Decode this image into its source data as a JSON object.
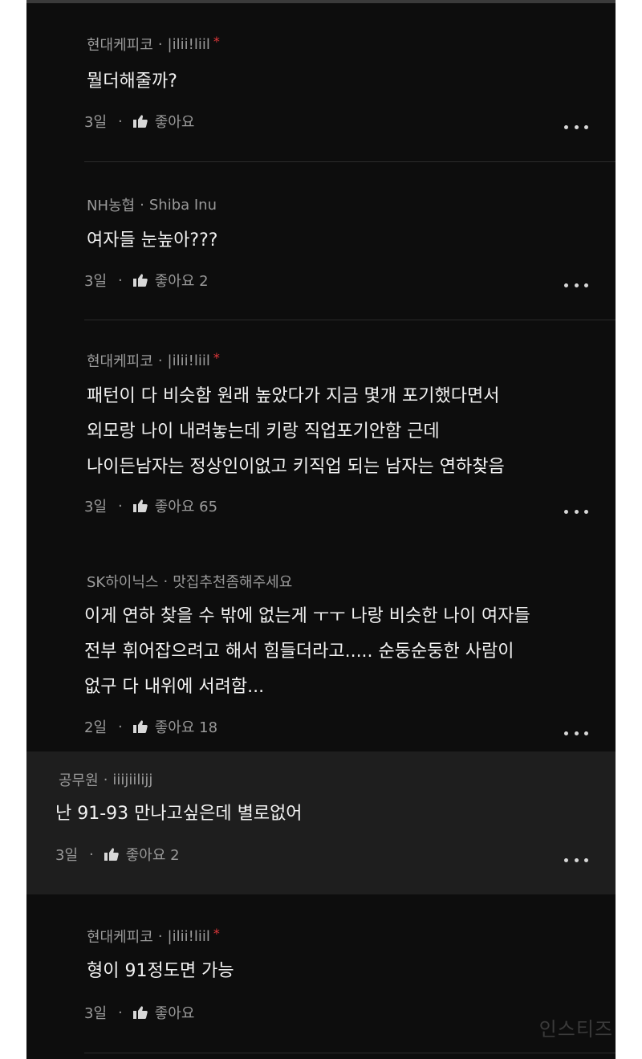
{
  "comments": [
    {
      "company": "현대케피코",
      "nickname": "|ilii!liil",
      "author_mark": "*",
      "lines": [
        "뭘더해줄까?"
      ],
      "time": "3일",
      "like_label": "좋아요"
    },
    {
      "company": "NH농협",
      "nickname": "Shiba Inu",
      "lines": [
        "여자들 눈높아???"
      ],
      "time": "3일",
      "like_label": "좋아요 2"
    },
    {
      "company": "현대케피코",
      "nickname": "|ilii!liil",
      "author_mark": "*",
      "lines": [
        "패턴이 다 비슷함 원래 높았다가 지금 몇개 포기했다면서",
        "외모랑 나이 내려놓는데 키랑 직업포기안함 근데",
        "나이든남자는 정상인이없고 키직업 되는 남자는 연하찾음"
      ],
      "time": "3일",
      "like_label": "좋아요 65"
    },
    {
      "company": "SK하이닉스",
      "nickname": "맛집추천좀해주세요",
      "lines": [
        "이게 연하 찾을 수 밖에 없는게 ㅜㅜ 나랑 비슷한 나이 여자들",
        "전부 휘어잡으려고 해서 힘들더라고..... 순둥순둥한 사람이",
        "없구 다 내위에 서려함..."
      ],
      "time": "2일",
      "like_label": "좋아요 18"
    },
    {
      "company": "공무원",
      "nickname": "iiijiilijj",
      "lines": [
        "난 91-93 만나고싶은데 별로없어"
      ],
      "time": "3일",
      "like_label": "좋아요 2"
    },
    {
      "company": "현대케피코",
      "nickname": "|ilii!liil",
      "author_mark": "*",
      "lines": [
        "형이 91정도면 가능"
      ],
      "time": "3일",
      "like_label": "좋아요"
    }
  ],
  "separator": "·",
  "icons": {
    "like": "thumbs-up-icon",
    "more": "more-dots-icon"
  },
  "watermark": "인스티즈",
  "colors": {
    "background": "#0d0d0d",
    "highlight": "#1e1e1e",
    "author_mark": "#e0383b",
    "text": "#f2f2f2",
    "meta": "#9a9a9a"
  }
}
